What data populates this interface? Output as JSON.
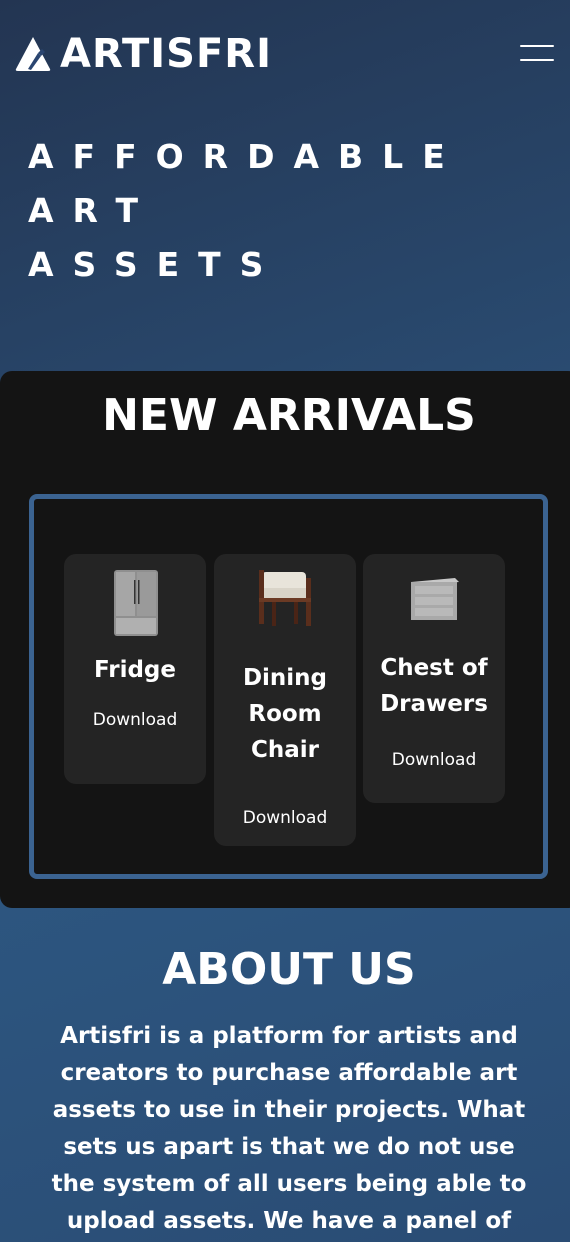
{
  "header": {
    "brand": "ARTISFRI",
    "logo_icon": "artisfri-logo-icon",
    "menu_icon": "hamburger-menu-icon"
  },
  "hero": {
    "lines": [
      "AFFORDABLE",
      "ART",
      "ASSETS"
    ]
  },
  "arrivals": {
    "title": "NEW ARRIVALS",
    "items": [
      {
        "title": "Fridge",
        "link": "Download",
        "icon": "fridge-thumbnail"
      },
      {
        "title": "Dining Room Chair",
        "link": "Download",
        "icon": "chair-thumbnail"
      },
      {
        "title": "Chest of Drawers",
        "link": "Download",
        "icon": "drawers-thumbnail"
      }
    ]
  },
  "about": {
    "title": "ABOUT US",
    "text": "Artisfri is a platform for artists and creators to purchase affordable art assets to use in their projects. What sets us apart is that we do not use the system of all users being able to upload assets. We have a panel of"
  },
  "colors": {
    "background_top": "#233552",
    "background_bottom": "#2d5680",
    "panel": "#141414",
    "card": "#242424",
    "carousel_border": "#3b6391",
    "text": "#ffffff"
  }
}
